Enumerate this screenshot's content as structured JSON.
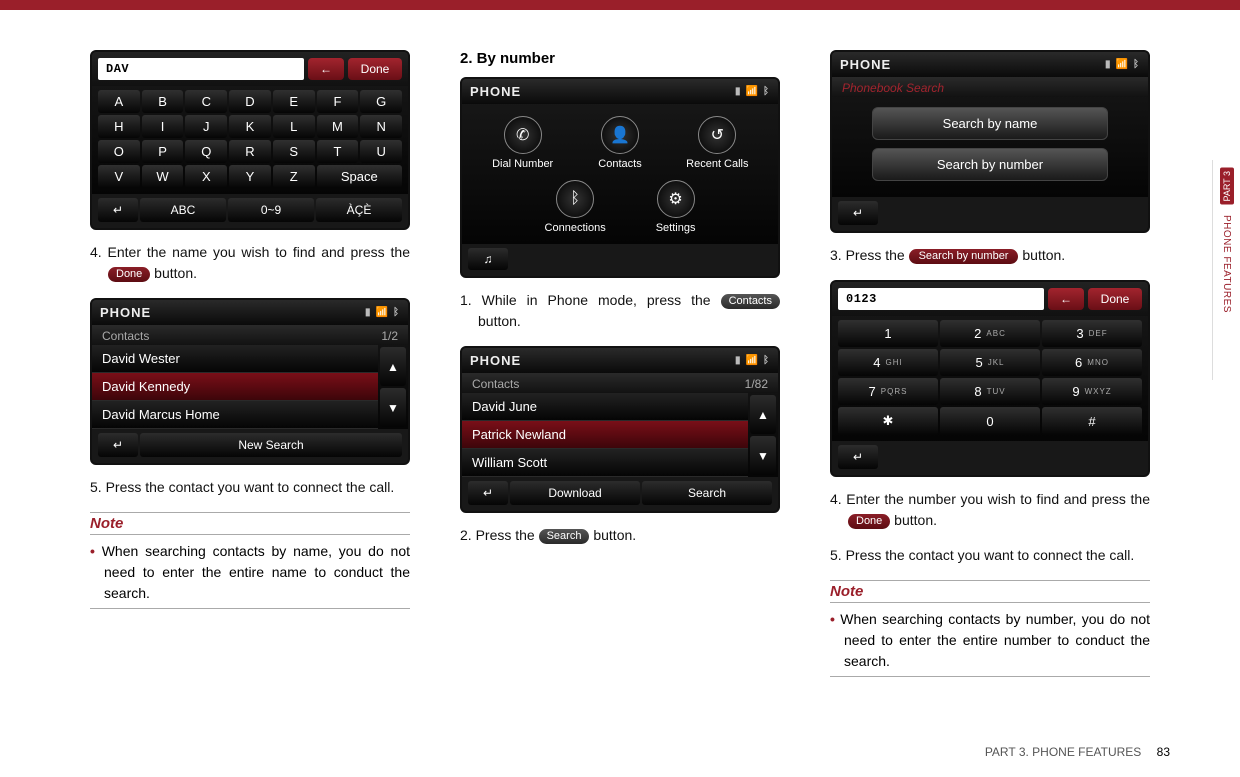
{
  "page": {
    "footer_section": "PART 3. PHONE FEATURES",
    "footer_page": "83",
    "sidetab_part": "PART 3",
    "sidetab_label": "PHONE FEATURES"
  },
  "col1": {
    "kbd_screenshot": {
      "field_value": "DAV",
      "back_icon": "←",
      "done": "Done",
      "keys": [
        "A",
        "B",
        "C",
        "D",
        "E",
        "F",
        "G",
        "H",
        "I",
        "J",
        "K",
        "L",
        "M",
        "N",
        "O",
        "P",
        "Q",
        "R",
        "S",
        "T",
        "U",
        "V",
        "W",
        "X",
        "Y",
        "Z"
      ],
      "space": "Space",
      "bottom": {
        "back": "↵",
        "abc": "ABC",
        "numrange": "0~9",
        "accents": "ÀÇÈ"
      }
    },
    "step4": "4. Enter the name you wish to find and press the ",
    "step4_btn": "Done",
    "step4_tail": " button.",
    "results_screenshot": {
      "title": "PHONE",
      "subtitle": "Contacts",
      "page_indicator": "1/2",
      "rows": [
        "David Wester",
        "David Kennedy",
        "David Marcus Home"
      ],
      "back": "↵",
      "newsearch": "New Search"
    },
    "step5": "5. Press the contact you want to connect the call.",
    "note_title": "Note",
    "note_text": "When searching contacts by name, you do not need to enter the entire name to conduct the search."
  },
  "col2": {
    "heading": "2. By number",
    "menu_screenshot": {
      "title": "PHONE",
      "items_top": [
        "Dial Number",
        "Contacts",
        "Recent Calls"
      ],
      "items_bot": [
        "Connections",
        "Settings"
      ],
      "media_icon": "♫"
    },
    "step1": "1. While in Phone mode, press the ",
    "step1_btn": "Contacts",
    "step1_tail": " button.",
    "contacts_screenshot": {
      "title": "PHONE",
      "subtitle": "Contacts",
      "page_indicator": "1/82",
      "rows": [
        "David June",
        "Patrick Newland",
        "William Scott"
      ],
      "back": "↵",
      "download": "Download",
      "search": "Search"
    },
    "step2": "2. Press the ",
    "step2_btn": "Search",
    "step2_tail": " button."
  },
  "col3": {
    "search_screenshot": {
      "title": "PHONE",
      "subtitle": "Phonebook Search",
      "btn_name": "Search by name",
      "btn_number": "Search by number",
      "back": "↵"
    },
    "step3": "3. Press the ",
    "step3_btn": "Search by number",
    "step3_tail": "  button.",
    "numpad_screenshot": {
      "field_value": "0123",
      "back_icon": "←",
      "done": "Done",
      "keys": [
        {
          "n": "1",
          "s": ""
        },
        {
          "n": "2",
          "s": "ABC"
        },
        {
          "n": "3",
          "s": "DEF"
        },
        {
          "n": "4",
          "s": "GHI"
        },
        {
          "n": "5",
          "s": "JKL"
        },
        {
          "n": "6",
          "s": "MNO"
        },
        {
          "n": "7",
          "s": "PQRS"
        },
        {
          "n": "8",
          "s": "TUV"
        },
        {
          "n": "9",
          "s": "WXYZ"
        },
        {
          "n": "✱",
          "s": ""
        },
        {
          "n": "0",
          "s": ""
        },
        {
          "n": "#",
          "s": ""
        }
      ],
      "back": "↵"
    },
    "step4": "4. Enter the number you wish to find and press the ",
    "step4_btn": "Done",
    "step4_tail": " button.",
    "step5": "5. Press the contact you want to connect the call.",
    "note_title": "Note",
    "note_text": "When searching contacts by number, you do not need to enter the entire number to conduct the search."
  }
}
